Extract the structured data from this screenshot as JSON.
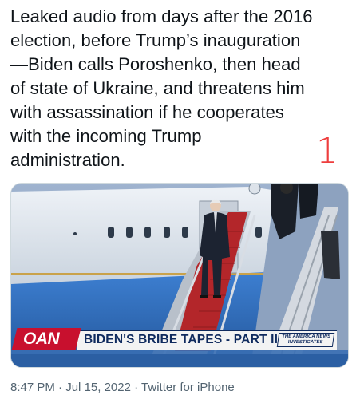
{
  "tweet": {
    "text": "Leaked audio from days after the 2016 election, before Trump’s inauguration —Biden calls Poroshenko, then head of state of Ukraine, and threatens him with assassination if he cooperates with the incoming Trump administration.",
    "text_lines": [
      "Leaked audio from days after the 2016",
      "election, before Trump’s inauguration",
      "—Biden calls Poroshenko, then head",
      "of state of Ukraine, and threatens him",
      "with assassination if he cooperates",
      "with the incoming Trump",
      "administration."
    ],
    "annotation": "1",
    "annotation_color": "#ee3e3e"
  },
  "media": {
    "network_logo": "OAN",
    "chyron": "BIDEN'S BRIBE TAPES - PART II",
    "chyron_logo_lines": [
      "THE AMERICA NEWS",
      "INVESTIGATES"
    ],
    "colors": {
      "oan_red": "#c8102e",
      "chyron_navy": "#0f2a5e",
      "plane_blue": "#2f6fc4",
      "carpet_red": "#b3262a"
    }
  },
  "meta": {
    "time": "8:47 PM",
    "separator": "·",
    "date": "Jul 15, 2022",
    "source": "Twitter for iPhone"
  }
}
